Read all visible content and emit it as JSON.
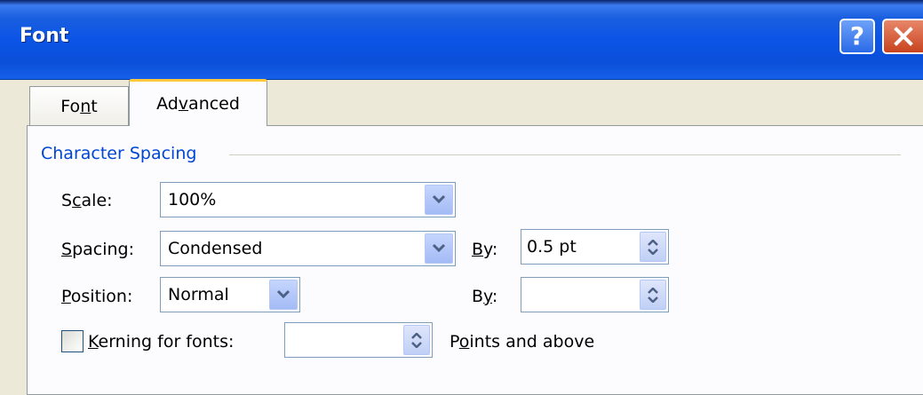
{
  "window": {
    "title": "Font"
  },
  "title_buttons": {
    "help_glyph": "?",
    "help_icon": "help-icon",
    "close_icon": "close-icon"
  },
  "tabs": [
    {
      "label_parts": [
        "Fo",
        "n",
        "t"
      ],
      "selected": false
    },
    {
      "label_parts": [
        "Ad",
        "v",
        "anced"
      ],
      "selected": true
    }
  ],
  "group": {
    "title": "Character Spacing"
  },
  "scale": {
    "label_parts": [
      "S",
      "c",
      "ale:"
    ],
    "value": "100%"
  },
  "spacing": {
    "label_parts": [
      "",
      "S",
      "pacing:"
    ],
    "value": "Condensed",
    "by_label_parts": [
      "",
      "B",
      "y:"
    ],
    "by_value": "0.5 pt"
  },
  "position": {
    "label_parts": [
      "",
      "P",
      "osition:"
    ],
    "value": "Normal",
    "by_label_parts": [
      "B",
      "y",
      ":"
    ],
    "by_value": ""
  },
  "kerning": {
    "checked": false,
    "label_parts": [
      "",
      "K",
      "erning for fonts:"
    ],
    "value": "",
    "suffix_parts": [
      "P",
      "o",
      "ints and above"
    ]
  },
  "colors": {
    "titlebar": "#0b54e6",
    "group_title": "#0046d5",
    "active_tab_accent": "#ffc83c"
  }
}
